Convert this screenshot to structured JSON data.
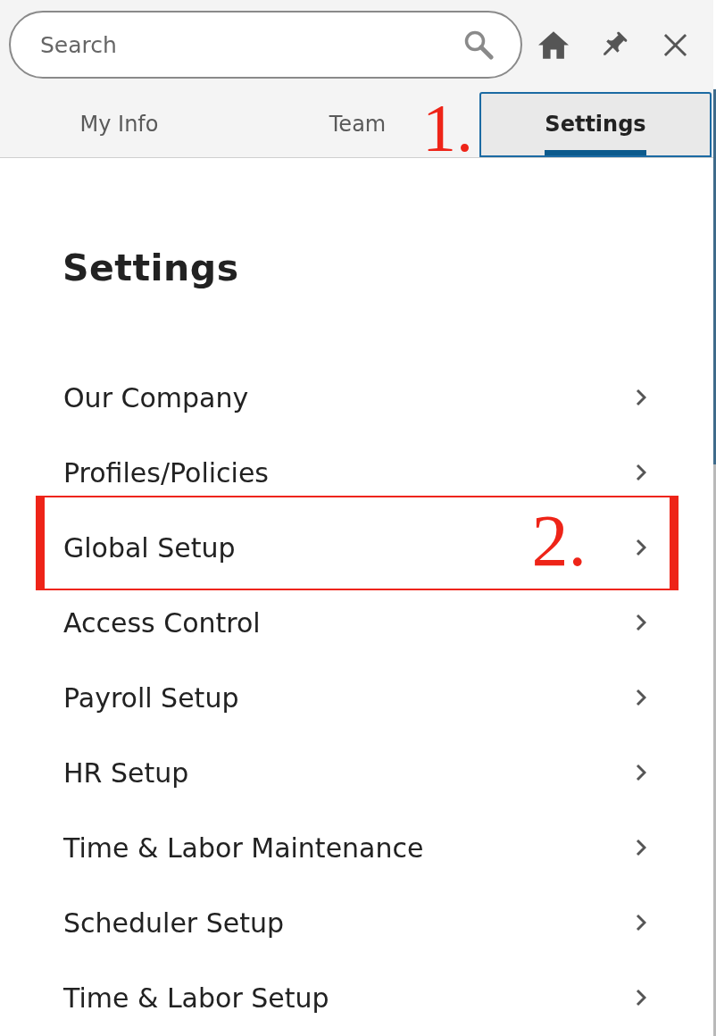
{
  "toolbar": {
    "search": {
      "placeholder": "Search"
    }
  },
  "tabs": [
    {
      "label": "My Info",
      "selected": false
    },
    {
      "label": "Team",
      "selected": false
    },
    {
      "label": "Settings",
      "selected": true,
      "callout": "1."
    }
  ],
  "page": {
    "heading": "Settings",
    "items": [
      {
        "label": "Our Company",
        "highlighted": false
      },
      {
        "label": "Profiles/Policies",
        "highlighted": false
      },
      {
        "label": "Global Setup",
        "highlighted": true,
        "callout": "2."
      },
      {
        "label": "Access Control",
        "highlighted": false
      },
      {
        "label": "Payroll Setup",
        "highlighted": false
      },
      {
        "label": "HR Setup",
        "highlighted": false
      },
      {
        "label": "Time & Labor Maintenance",
        "highlighted": false
      },
      {
        "label": "Scheduler Setup",
        "highlighted": false
      },
      {
        "label": "Time & Labor Setup",
        "highlighted": false
      }
    ]
  }
}
